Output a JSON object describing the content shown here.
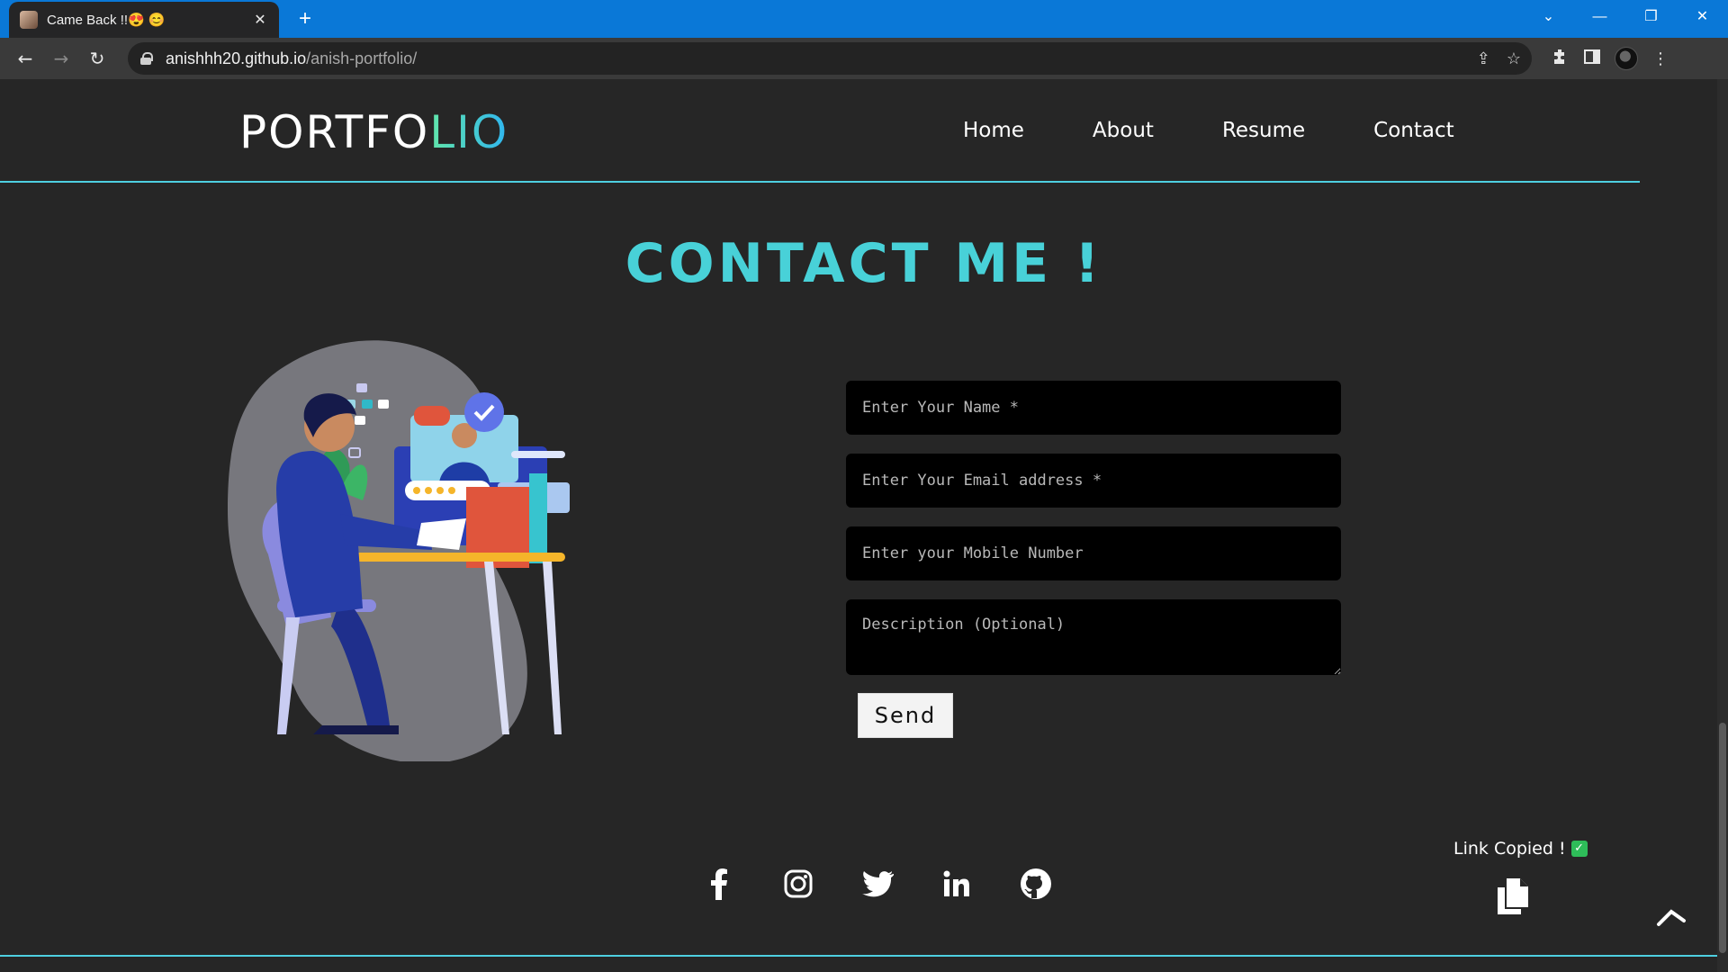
{
  "browser": {
    "tab_title": "Came Back !!😍 😊",
    "tab_close": "✕",
    "new_tab": "+",
    "url_host": "anishhh20.github.io",
    "url_path": "/anish-portfolio/",
    "window_controls": [
      "⌄",
      "—",
      "❐",
      "✕"
    ]
  },
  "header": {
    "logo_part1": "PORTFO",
    "logo_part2": "LIO",
    "nav": [
      "Home",
      "About",
      "Resume",
      "Contact"
    ]
  },
  "contact": {
    "title": "CONTACT ME !",
    "name_placeholder": "Enter Your Name *",
    "email_placeholder": "Enter Your Email address *",
    "mobile_placeholder": "Enter your Mobile Number",
    "description_placeholder": "Description (Optional)",
    "send_label": "Send"
  },
  "socials": [
    "facebook-icon",
    "instagram-icon",
    "twitter-icon",
    "linkedin-icon",
    "github-icon"
  ],
  "share": {
    "link_copied": "Link Copied !",
    "check": "✓"
  },
  "colors": {
    "accent": "#48d1d8",
    "background": "#262626",
    "browser_blue": "#0a78d7"
  }
}
